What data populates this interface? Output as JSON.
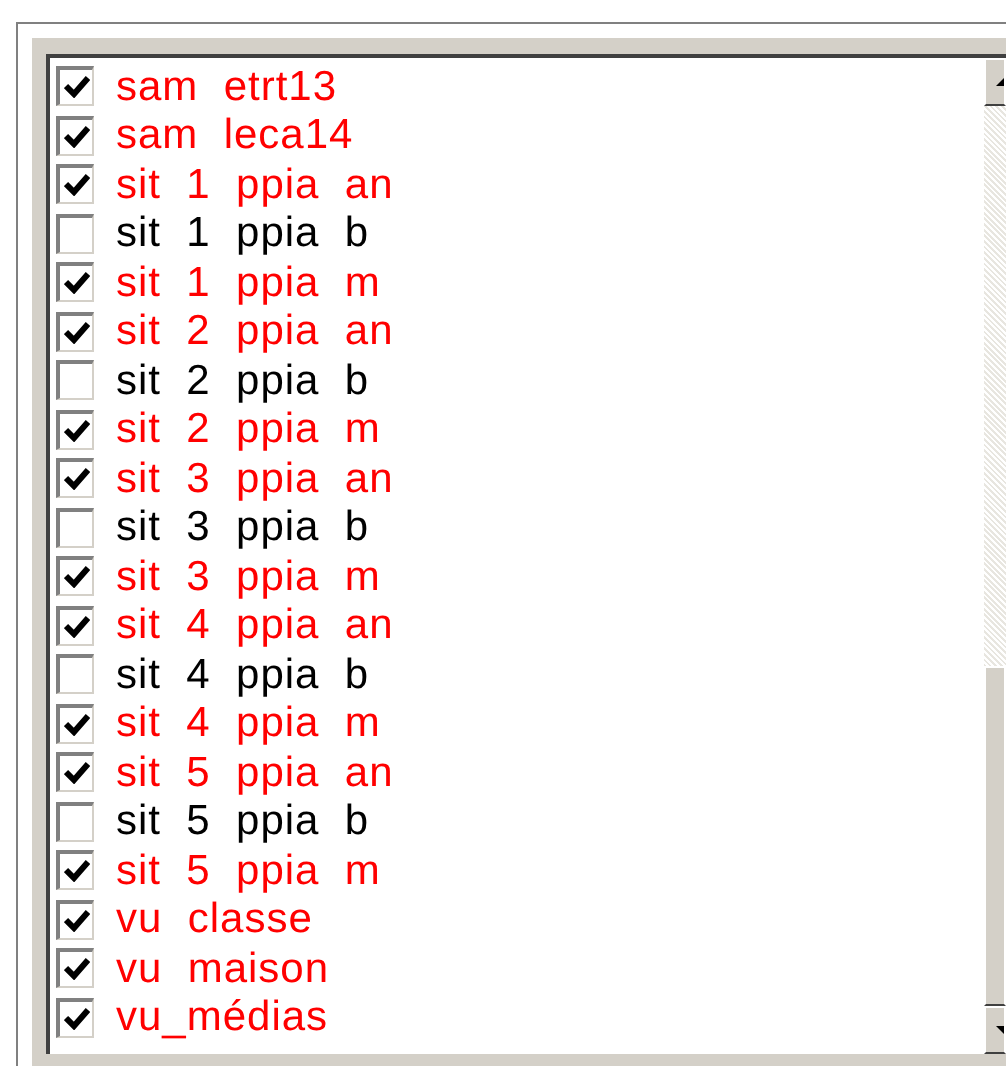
{
  "items": [
    {
      "label": "sam  etrt13",
      "checked": true
    },
    {
      "label": "sam  leca14",
      "checked": true
    },
    {
      "label": "sit  1  ppia  an",
      "checked": true
    },
    {
      "label": "sit  1  ppia  b",
      "checked": false
    },
    {
      "label": "sit  1  ppia  m",
      "checked": true
    },
    {
      "label": "sit  2  ppia  an",
      "checked": true
    },
    {
      "label": "sit  2  ppia  b",
      "checked": false
    },
    {
      "label": "sit  2  ppia  m",
      "checked": true
    },
    {
      "label": "sit  3  ppia  an",
      "checked": true
    },
    {
      "label": "sit  3  ppia  b",
      "checked": false
    },
    {
      "label": "sit  3  ppia  m",
      "checked": true
    },
    {
      "label": "sit  4  ppia  an",
      "checked": true
    },
    {
      "label": "sit  4  ppia  b",
      "checked": false
    },
    {
      "label": "sit  4  ppia  m",
      "checked": true
    },
    {
      "label": "sit  5  ppia  an",
      "checked": true
    },
    {
      "label": "sit  5  ppia  b",
      "checked": false
    },
    {
      "label": "sit  5  ppia  m",
      "checked": true
    },
    {
      "label": "vu  classe",
      "checked": true
    },
    {
      "label": "vu  maison",
      "checked": true
    },
    {
      "label": "vu_médias",
      "checked": true
    }
  ]
}
